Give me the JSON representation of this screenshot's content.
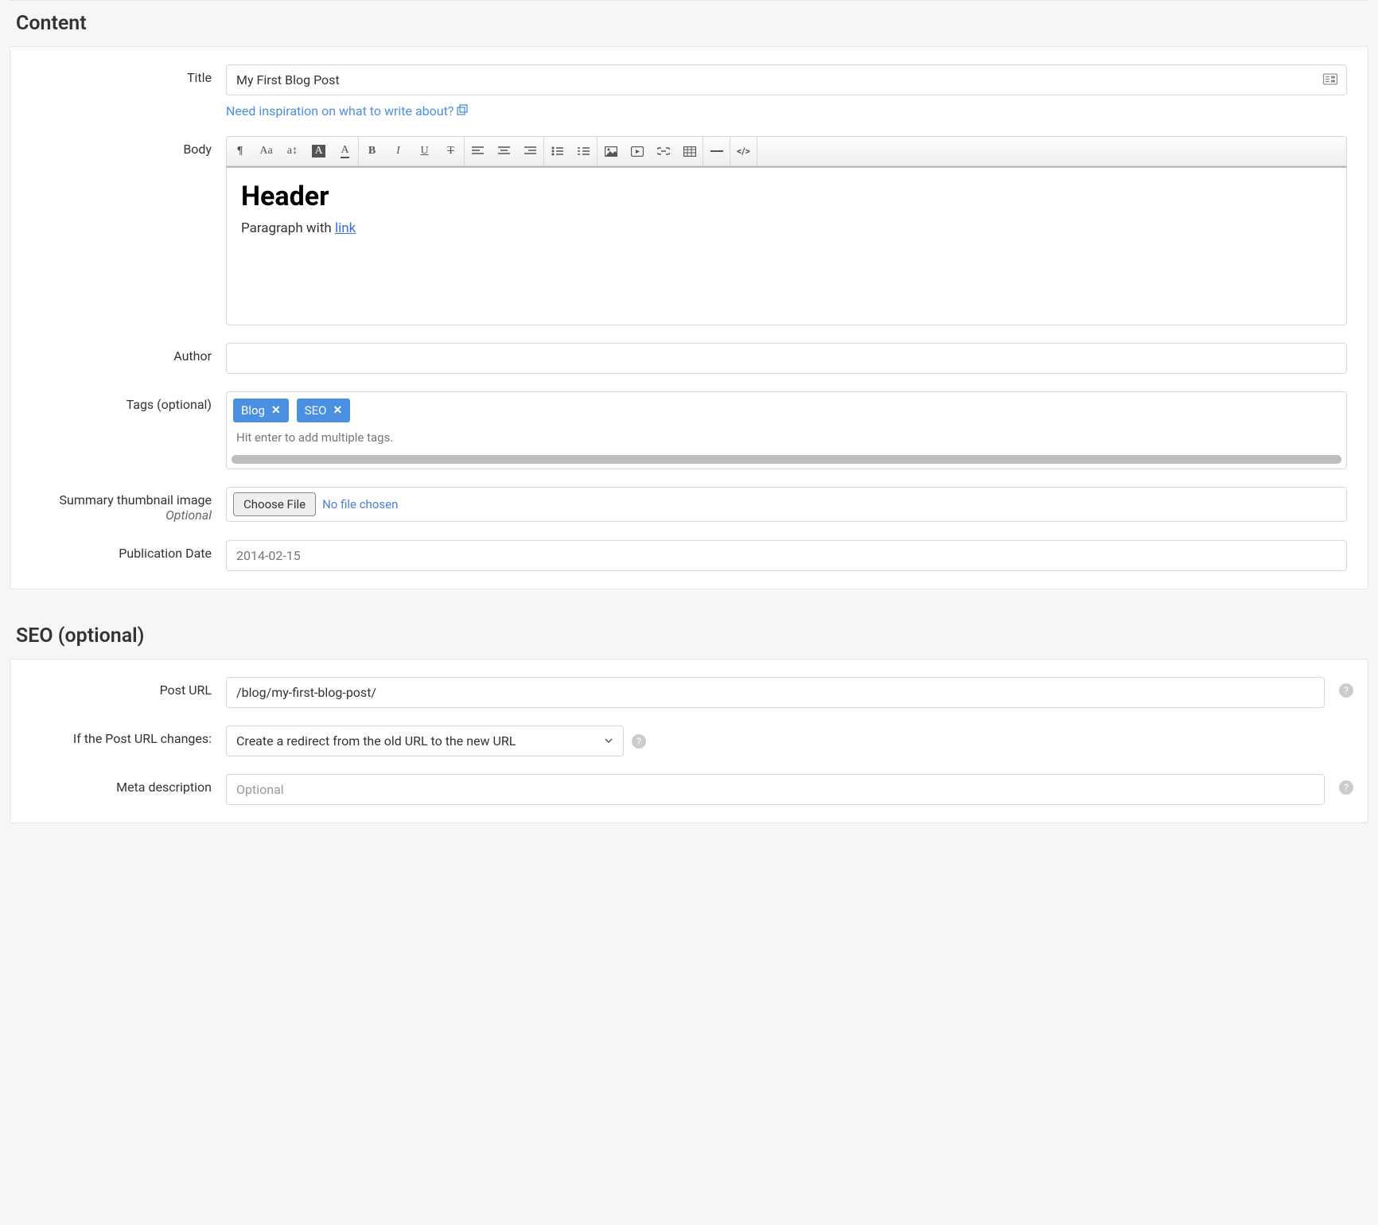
{
  "sections": {
    "content_header": "Content",
    "seo_header": "SEO (optional)"
  },
  "fields": {
    "title": {
      "label": "Title",
      "value": "My First Blog Post"
    },
    "inspiration_link": "Need inspiration on what to write about?",
    "body": {
      "label": "Body",
      "header_text": "Header",
      "paragraph_prefix": "Paragraph with ",
      "paragraph_link": "link"
    },
    "author": {
      "label": "Author",
      "value": ""
    },
    "tags": {
      "label": "Tags (optional)",
      "items": [
        "Blog",
        "SEO"
      ],
      "help": "Hit enter to add multiple tags."
    },
    "thumbnail": {
      "label": "Summary thumbnail image",
      "sublabel": "Optional",
      "button": "Choose File",
      "status": "No file chosen"
    },
    "pub_date": {
      "label": "Publication Date",
      "value": "2014-02-15"
    },
    "post_url": {
      "label": "Post URL",
      "value": "/blog/my-first-blog-post/"
    },
    "url_change": {
      "label": "If the Post URL changes:",
      "selected": "Create a redirect from the old URL to the new URL"
    },
    "meta_desc": {
      "label": "Meta description",
      "placeholder": "Optional"
    }
  },
  "toolbar_icons": [
    "paragraph-icon",
    "font-case-icon",
    "line-height-icon",
    "highlight-icon",
    "text-color-icon",
    "bold-icon",
    "italic-icon",
    "underline-icon",
    "strikethrough-icon",
    "align-left-icon",
    "align-center-icon",
    "align-right-icon",
    "unordered-list-icon",
    "ordered-list-icon",
    "image-icon",
    "video-icon",
    "link-icon",
    "table-icon",
    "horizontal-rule-icon",
    "code-icon"
  ]
}
